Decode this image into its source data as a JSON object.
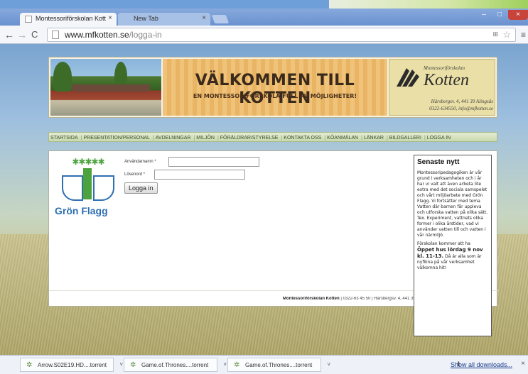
{
  "browser": {
    "tabs": [
      {
        "label": "Montessoriförskolan Kott",
        "active": true
      },
      {
        "label": "New Tab",
        "active": false
      }
    ],
    "url_host": "www.mfkotten.se",
    "url_path": "/logga-in"
  },
  "site": {
    "banner_title": "VÄLKOMMEN TILL KOTTEN",
    "banner_subtitle": "EN MONTESSORIFÖRSKOLA FULL AV MÖJLIGHETER!",
    "logo_small": "Montessoriförskolan",
    "logo_brand": "Kotten",
    "logo_address": "Härsbergsv. 4, 441 39 Alingsås",
    "logo_contact": "0322-634550, info@mfkotten.se",
    "nav": [
      "STARTSIDA",
      "PRESENTATION/PERSONAL",
      "AVDELNINGAR",
      "MILJÖN",
      "FÖRÄLDRAR/STYRELSE",
      "KONTAKTA OSS",
      "KÖANMÄLAN",
      "LÄNKAR",
      "BILDGALLERI",
      "LOGGA IN"
    ],
    "flag_text": "Grön Flagg",
    "login": {
      "username_label": "Användarnamn *",
      "password_label": "Lösenord *",
      "submit_label": "Logga in"
    },
    "footer_name": "Montessoriförskolan Kotten",
    "footer_rest": " | 0322-63 45 50 | Härsbergsv. 4, 441 39 Alingsås",
    "news": {
      "heading": "Senaste nytt",
      "para1": "Montessoripedagogiken är vår grund i verksamheten och i år har vi valt att även arbeta lite extra med det sociala samspelet och vårt miljöarbete med Grön Flagg. Vi fortsätter med tema Vatten där barnen får uppleva och utforska vatten på olika sätt. Tex. Experiment, vattnets olika former i olika årstider, vad vi använder vatten till och vatten i vår närmiljö.",
      "para2_start": "Förskolan kommer att ha ",
      "para2_bold": "Öppet hus lördag 9 nov kl. 11-13.",
      "para2_end": " Då är alla som är nyfikna på vår verksamhet välkomna hit!"
    }
  },
  "downloads": {
    "items": [
      "Arrow.S02E19.HD....torrent",
      "Game.of.Thrones....torrent",
      "Game.of.Thrones....torrent"
    ],
    "show_all": "Show all downloads..."
  }
}
